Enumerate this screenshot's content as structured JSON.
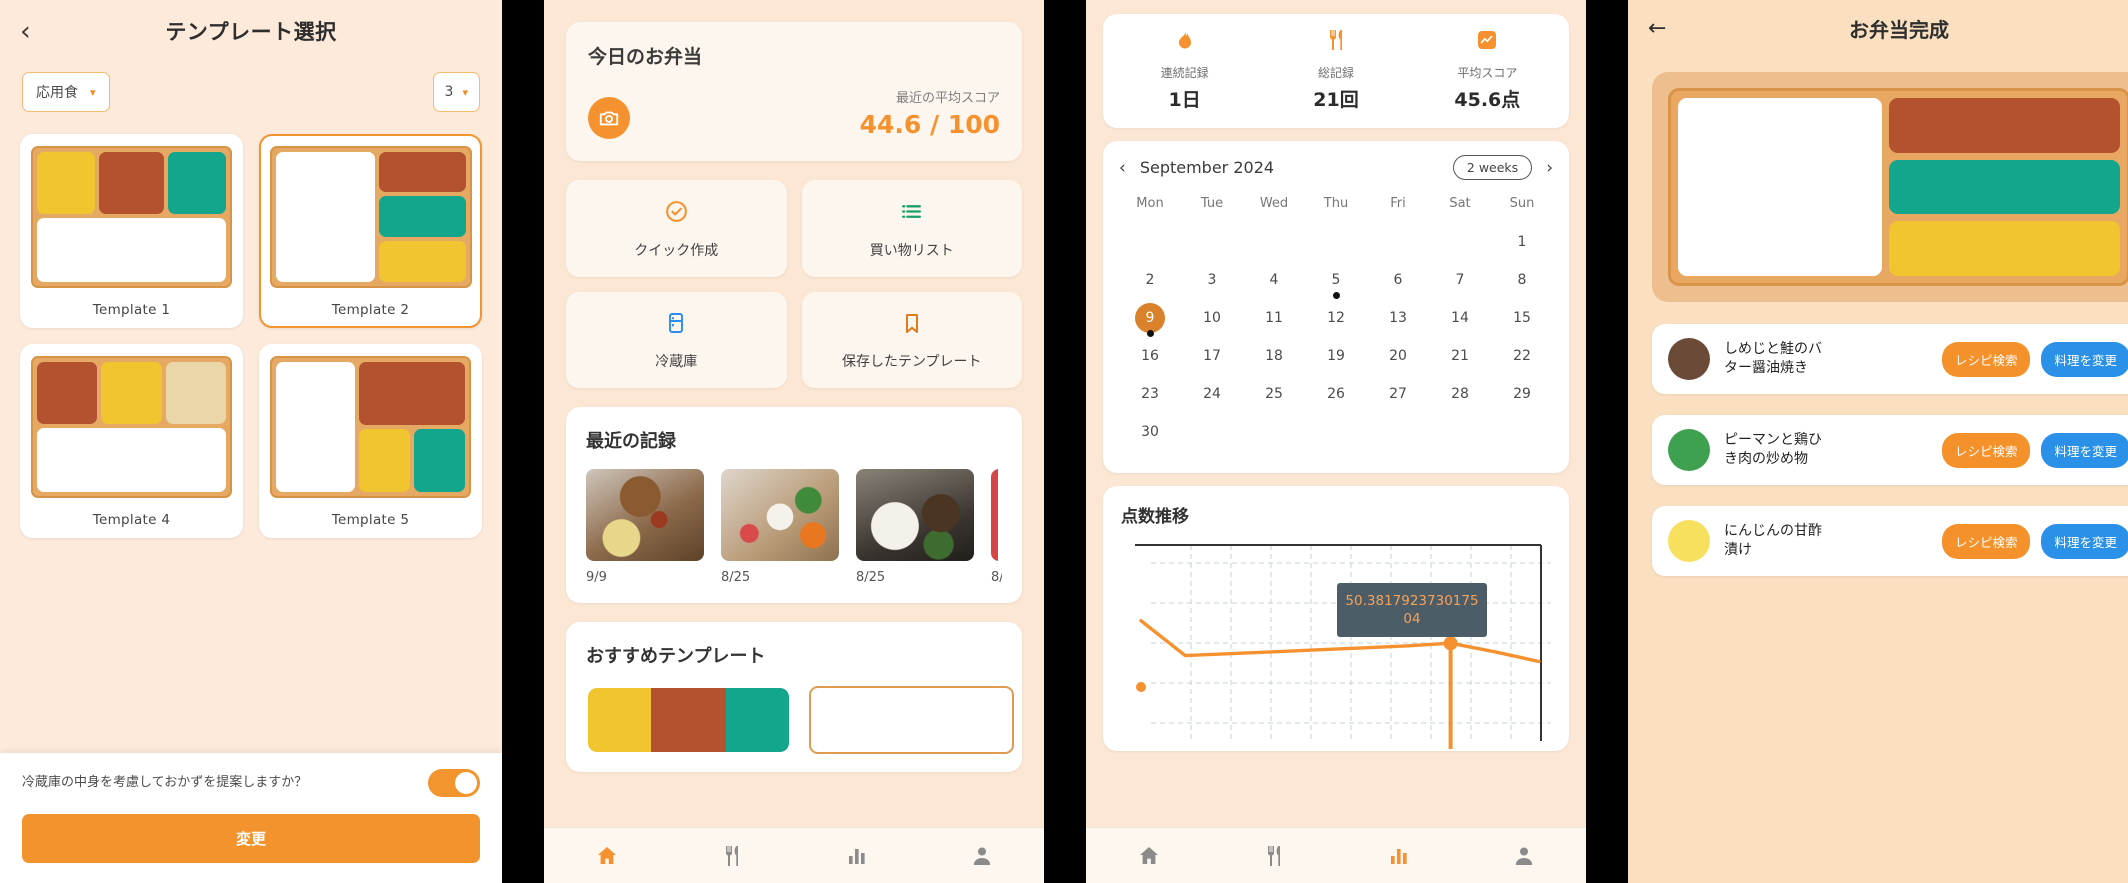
{
  "panel1": {
    "header": {
      "back_icon": "chevron-left-icon",
      "title": "テンプレート選択"
    },
    "filters": {
      "category": {
        "value": "応用食",
        "caret": "▾"
      },
      "count": {
        "value": "3",
        "caret": "▾"
      }
    },
    "templates": [
      {
        "name": "Template 1",
        "selected": false
      },
      {
        "name": "Template 2",
        "selected": true
      },
      {
        "name": "Template 4",
        "selected": false
      },
      {
        "name": "Template 5",
        "selected": false
      }
    ],
    "bottom": {
      "question": "冷蔵庫の中身を考慮しておかずを提案しますか？",
      "toggle_on": true,
      "button_label": "変更"
    }
  },
  "panel2": {
    "today": {
      "title": "今日のお弁当",
      "camera_icon": "camera-icon",
      "score_label": "最近の平均スコア",
      "score_value": "44.6 / 100"
    },
    "quick_actions": [
      {
        "icon": "check-circle-icon",
        "label": "クイック作成",
        "color": "#f5922f"
      },
      {
        "icon": "list-icon",
        "label": "買い物リスト",
        "color": "#18a06a"
      },
      {
        "icon": "fridge-icon",
        "label": "冷蔵庫",
        "color": "#2a8cf0"
      },
      {
        "icon": "bookmark-icon",
        "label": "保存したテンプレート",
        "color": "#e07b1e"
      }
    ],
    "recent": {
      "title": "最近の記録",
      "items": [
        {
          "date": "9/9"
        },
        {
          "date": "8/25"
        },
        {
          "date": "8/25"
        },
        {
          "date": "8/"
        }
      ]
    },
    "recommended": {
      "title": "おすすめテンプレート"
    },
    "nav": [
      {
        "icon": "home-icon",
        "active": true
      },
      {
        "icon": "utensils-icon",
        "active": false
      },
      {
        "icon": "chart-icon",
        "active": false
      },
      {
        "icon": "person-icon",
        "active": false
      }
    ]
  },
  "panel3": {
    "stats": [
      {
        "icon": "flame-icon",
        "label": "連続記録",
        "value": "1日"
      },
      {
        "icon": "utensils-icon",
        "label": "総記録",
        "value": "21回"
      },
      {
        "icon": "score-icon",
        "label": "平均スコア",
        "value": "45.6点"
      }
    ],
    "calendar": {
      "prev_icon": "chevron-left-icon",
      "next_icon": "chevron-right-icon",
      "month": "September 2024",
      "range_chip": "2 weeks",
      "dow": [
        "Mon",
        "Tue",
        "Wed",
        "Thu",
        "Fri",
        "Sat",
        "Sun"
      ],
      "leading_blanks": 6,
      "days": [
        {
          "n": "1"
        },
        {
          "n": "2"
        },
        {
          "n": "3"
        },
        {
          "n": "4"
        },
        {
          "n": "5",
          "dot": true
        },
        {
          "n": "6"
        },
        {
          "n": "7"
        },
        {
          "n": "8"
        },
        {
          "n": "9",
          "today": true,
          "dot": true
        },
        {
          "n": "10"
        },
        {
          "n": "11"
        },
        {
          "n": "12"
        },
        {
          "n": "13"
        },
        {
          "n": "14"
        },
        {
          "n": "15"
        },
        {
          "n": "16"
        },
        {
          "n": "17"
        },
        {
          "n": "18"
        },
        {
          "n": "19"
        },
        {
          "n": "20"
        },
        {
          "n": "21"
        },
        {
          "n": "22"
        },
        {
          "n": "23"
        },
        {
          "n": "24"
        },
        {
          "n": "25"
        },
        {
          "n": "26"
        },
        {
          "n": "27"
        },
        {
          "n": "28"
        },
        {
          "n": "29"
        },
        {
          "n": "30"
        }
      ]
    },
    "chart_title": "点数推移",
    "tooltip": "50.381792373017504",
    "nav": [
      {
        "icon": "home-icon",
        "active": false
      },
      {
        "icon": "utensils-icon",
        "active": false
      },
      {
        "icon": "chart-icon",
        "active": true
      },
      {
        "icon": "person-icon",
        "active": false
      }
    ]
  },
  "panel4": {
    "header": {
      "back_icon": "arrow-left-icon",
      "title": "お弁当完成",
      "save_icon": "save-icon"
    },
    "foods": [
      {
        "color": "#6b4a38",
        "name": "しめじと鮭のバター醤油焼き",
        "recipe_label": "レシピ検索",
        "change_label": "料理を変更"
      },
      {
        "color": "#3fa14f",
        "name": "ピーマンと鶏ひき肉の炒め物",
        "recipe_label": "レシピ検索",
        "change_label": "料理を変更"
      },
      {
        "color": "#f7e05e",
        "name": "にんじんの甘酢漬け",
        "recipe_label": "レシピ検索",
        "change_label": "料理を変更"
      }
    ]
  },
  "chart_data": {
    "type": "line",
    "title": "点数推移",
    "xlabel": "",
    "ylabel": "",
    "ylim": [
      0,
      100
    ],
    "grid": true,
    "legend": "none",
    "series": [
      {
        "name": "score",
        "color": "#f5922f",
        "x": [
          0,
          1,
          2,
          3,
          4,
          5,
          6,
          7,
          8,
          9
        ],
        "values": [
          62,
          44,
          45,
          46,
          47,
          48,
          49,
          50.4,
          46,
          41
        ]
      }
    ],
    "annotations": [
      {
        "text": "50.381792373017504",
        "x": 7,
        "y": 50.38
      }
    ]
  },
  "colors": {
    "accent": "#f2932d",
    "bg": "#fce7d4",
    "bento_tray": "#e6a964",
    "yellow": "#f0c52f",
    "red": "#b4512e",
    "teal": "#14a68d",
    "cream": "#ead6a8",
    "blue": "#2a90e8"
  }
}
